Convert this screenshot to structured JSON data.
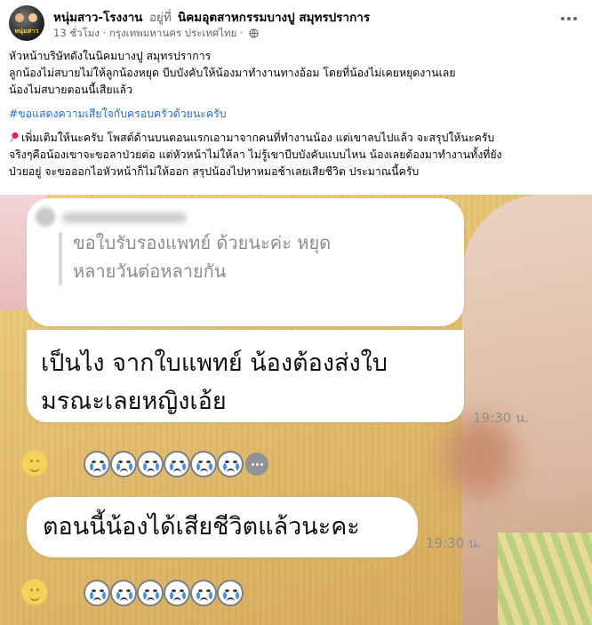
{
  "header": {
    "page_name": "หนุ่มสาว-โรงงาน",
    "at_word": "อยู่ที่",
    "location": "นิคมอุตสาหกรรมบางปู สมุทรปราการ",
    "time_ago": "13 ชั่วโมง",
    "place": "· กรุงเทพมหานคร ประเทศไทย ·",
    "avatar_text": "หนุ่มสาว"
  },
  "caption": {
    "line1": "หัวหน้าบริษัทดังในนิคมบางปู สมุทรปราการ",
    "line2": "ลูกน้องไม่สบายไม่ให้ลูกน้องหยุด บีบบังคับให้น้องมาทำงานทางอ้อม โดยที่น้องไม่เคยหยุดงานเลย",
    "line3": "น้องไม่สบายตอนนี้เสียแล้ว",
    "hashtag": "#ขอแสดงความเสียใจกับครอบครัวด้วยนะครับ",
    "para2_line1": "เพิ่มเติมให้นะครับ โพสต์ด้านบนตอนแรกเอามาจากคนที่ทำงานน้อง แต่เขาลบไปแล้ว จะสรุปให้นะครับ",
    "para2_line2": "จริงๆคือน้องเขาจะขอลาป่วยต่อ แต่หัวหน้าไม่ให้ลา ไม่รู้เขาบีบบังคับแบบไหน น้องเลยต้องมาทำงานทั้งที่ยัง",
    "para2_line3": "ป่วยอยู่  จะขอออกไอหัวหน้าก็ไม่ให้ออก สรุปน้องไปหาหมอช้าเลยเสียชีวิต ประมาณนี้ครับ"
  },
  "chat": {
    "quoted_line1": "ขอใบรับรองแพทย์ ด้วยนะค่ะ หยุด",
    "quoted_line2": "หลายวันต่อหลายกัน",
    "reply1_line1": "เป็นไง จากใบแพทย์ น้องต้องส่งใบ",
    "reply1_line2": "มรณะเลยหญิงเอ้ย",
    "time1": "19:30 น.",
    "reply2": "ตอนนี้น้องได้เสียชีวิตแล้วนะคะ",
    "time2": "19:30 น.",
    "reaction_count": 6
  },
  "colors": {
    "hashtag": "#216fdb",
    "meta": "#65676b",
    "pin": "#e0245e"
  }
}
